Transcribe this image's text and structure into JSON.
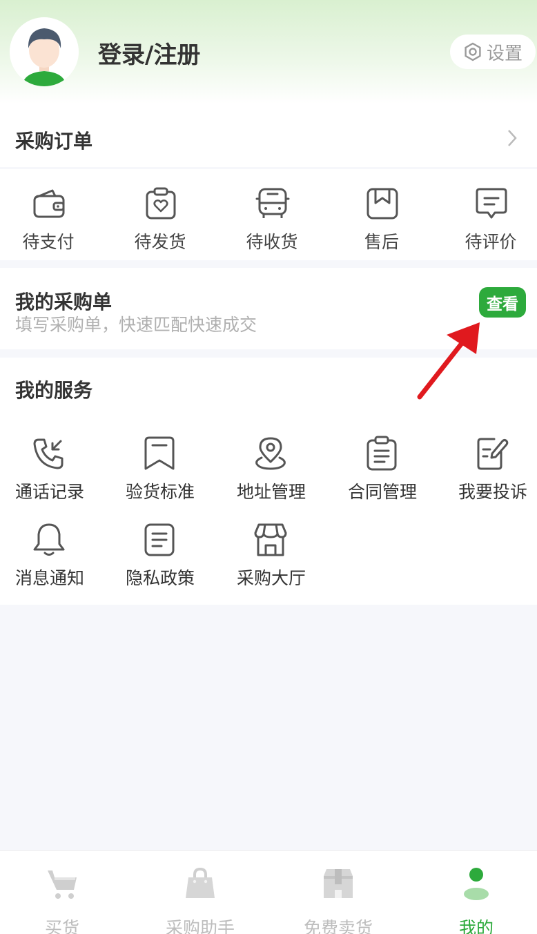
{
  "header": {
    "login_label": "登录/注册",
    "settings_label": "设置"
  },
  "orders": {
    "title": "采购订单",
    "items": [
      {
        "label": "待支付",
        "icon": "wallet-icon"
      },
      {
        "label": "待发货",
        "icon": "clipboard-heart-icon"
      },
      {
        "label": "待收货",
        "icon": "truck-icon"
      },
      {
        "label": "售后",
        "icon": "bookmark-box-icon"
      },
      {
        "label": "待评价",
        "icon": "comment-icon"
      }
    ]
  },
  "purchase_list": {
    "title": "我的采购单",
    "subtitle": "填写采购单，快速匹配快速成交",
    "view_label": "查看"
  },
  "services": {
    "title": "我的服务",
    "items": [
      {
        "label": "通话记录",
        "icon": "phone-icon"
      },
      {
        "label": "验货标准",
        "icon": "ribbon-icon"
      },
      {
        "label": "地址管理",
        "icon": "location-icon"
      },
      {
        "label": "合同管理",
        "icon": "clipboard-list-icon"
      },
      {
        "label": "我要投诉",
        "icon": "edit-icon"
      },
      {
        "label": "消息通知",
        "icon": "bell-icon"
      },
      {
        "label": "隐私政策",
        "icon": "document-icon"
      },
      {
        "label": "采购大厅",
        "icon": "store-icon"
      }
    ]
  },
  "tabbar": {
    "items": [
      {
        "label": "买货",
        "icon": "cart-icon"
      },
      {
        "label": "采购助手",
        "icon": "bag-icon"
      },
      {
        "label": "免费卖货",
        "icon": "package-icon"
      },
      {
        "label": "我的",
        "icon": "person-icon",
        "active": true
      }
    ]
  },
  "colors": {
    "accent": "#2daa3c",
    "annotation_arrow": "#e0191e"
  }
}
